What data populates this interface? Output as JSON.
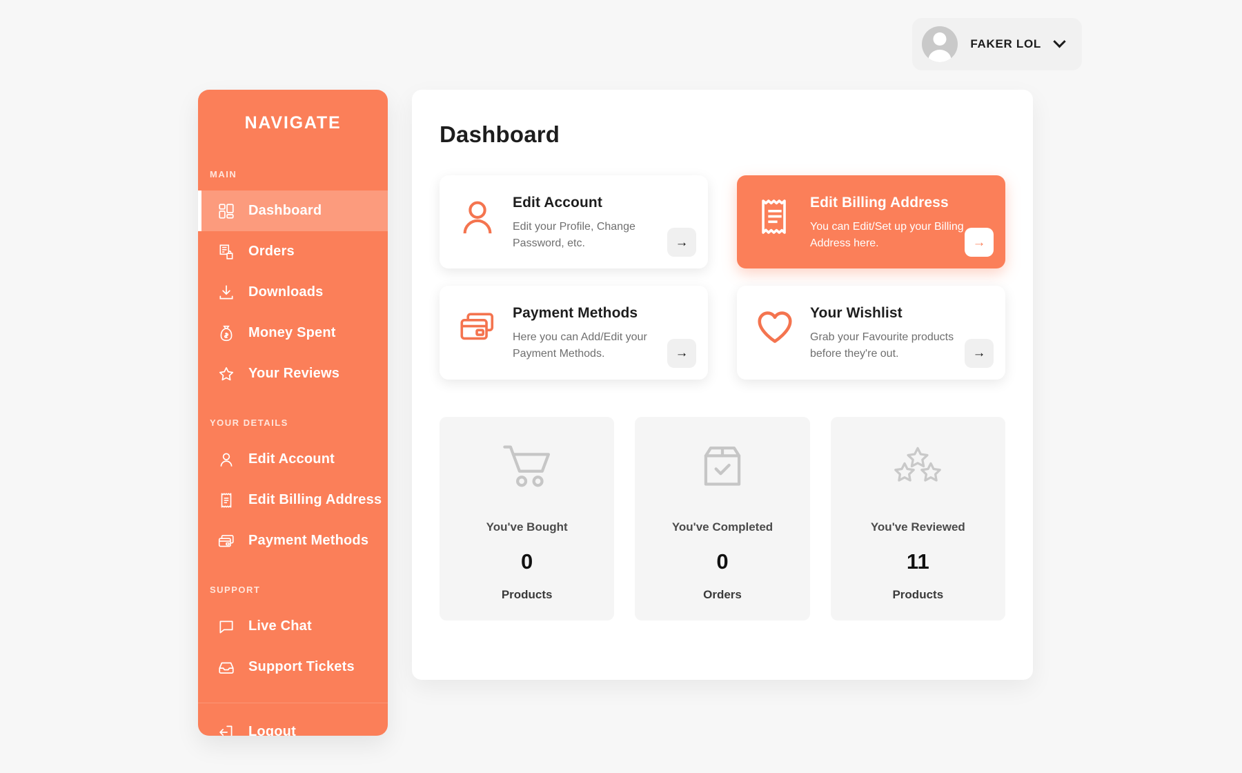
{
  "header": {
    "user_name": "FAKER LOL",
    "caret_icon": "chevron-down-icon",
    "avatar_icon": "user-avatar-icon"
  },
  "sidebar": {
    "title": "NAVIGATE",
    "groups": [
      {
        "label": "MAIN",
        "items": [
          {
            "label": "Dashboard",
            "icon": "dashboard-grid-icon",
            "active": true
          },
          {
            "label": "Orders",
            "icon": "orders-receipt-bag-icon",
            "active": false
          },
          {
            "label": "Downloads",
            "icon": "download-tray-icon",
            "active": false
          },
          {
            "label": "Money Spent",
            "icon": "money-bag-icon",
            "active": false
          },
          {
            "label": "Your Reviews",
            "icon": "star-outline-icon",
            "active": false
          }
        ]
      },
      {
        "label": "YOUR DETAILS",
        "items": [
          {
            "label": "Edit Account",
            "icon": "person-icon",
            "active": false
          },
          {
            "label": "Edit Billing Address",
            "icon": "receipt-icon",
            "active": false
          },
          {
            "label": "Payment Methods",
            "icon": "credit-cards-icon",
            "active": false
          }
        ]
      },
      {
        "label": "SUPPORT",
        "items": [
          {
            "label": "Live Chat",
            "icon": "chat-bubble-icon",
            "active": false
          },
          {
            "label": "Support Tickets",
            "icon": "inbox-icon",
            "active": false
          }
        ]
      }
    ],
    "logout": {
      "label": "Logout",
      "icon": "logout-icon"
    }
  },
  "main": {
    "page_title": "Dashboard",
    "cards": [
      {
        "title": "Edit Account",
        "description": "Edit your Profile, Change Password, etc.",
        "icon": "person-icon",
        "arrow": "→",
        "accent": false
      },
      {
        "title": "Edit Billing Address",
        "description": "You can Edit/Set up your Billing Address here.",
        "icon": "receipt-icon",
        "arrow": "→",
        "accent": true
      },
      {
        "title": "Payment Methods",
        "description": "Here you can Add/Edit your Payment Methods.",
        "icon": "credit-cards-icon",
        "arrow": "→",
        "accent": false
      },
      {
        "title": "Your Wishlist",
        "description": "Grab your Favourite products before they're out.",
        "icon": "heart-icon",
        "arrow": "→",
        "accent": false
      }
    ],
    "stats": [
      {
        "label": "You've Bought",
        "value": "0",
        "unit": "Products",
        "icon": "shopping-cart-icon"
      },
      {
        "label": "You've Completed",
        "value": "0",
        "unit": "Orders",
        "icon": "package-check-icon"
      },
      {
        "label": "You've Reviewed",
        "value": "11",
        "unit": "Products",
        "icon": "three-stars-icon"
      }
    ]
  },
  "colors": {
    "accent": "#fb7f59",
    "page_background": "#f7f7f7",
    "panel_background": "#ffffff",
    "stat_background": "#f5f5f5"
  }
}
